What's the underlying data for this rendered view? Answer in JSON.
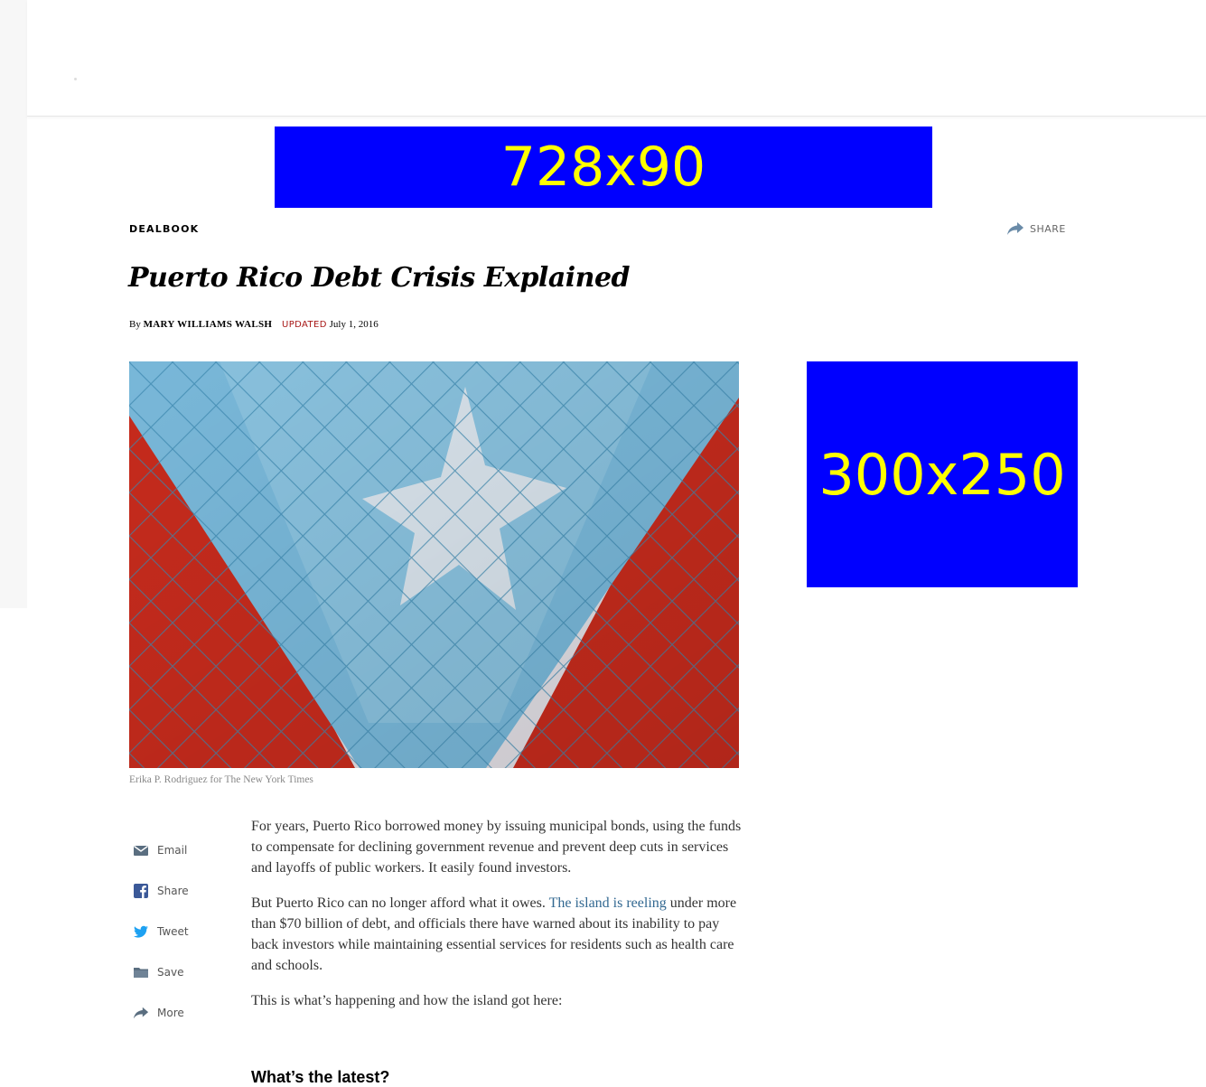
{
  "ads": {
    "top": "728x90",
    "side": "300x250"
  },
  "article": {
    "kicker": "DEALBOOK",
    "share_label": "SHARE",
    "headline": "Puerto Rico Debt Crisis Explained",
    "byline_prefix": "By",
    "author": "MARY WILLIAMS WALSH",
    "updated_label": "UPDATED",
    "date": "July 1, 2016",
    "photo_credit": "Erika P. Rodriguez for The New York Times",
    "paragraphs": {
      "p1": "For years, Puerto Rico borrowed money by issuing municipal bonds, using the funds to compensate for declining government revenue and prevent deep cuts in services and layoffs of public workers. It easily found investors.",
      "p2_before": "But Puerto Rico can no longer afford what it owes. ",
      "p2_link": "The island is reeling",
      "p2_after": " under more than $70 billion of debt, and officials there have warned about its inability to pay back investors while maintaining essential services for residents such as health care and schools.",
      "p3": "This is what’s happening and how the island got here:"
    },
    "subhead": "What’s the latest?"
  },
  "tools": {
    "email": "Email",
    "share": "Share",
    "tweet": "Tweet",
    "save": "Save",
    "more": "More"
  },
  "colors": {
    "ad_bg": "#0000ff",
    "ad_text": "#ffff00",
    "updated": "#a81817",
    "link": "#326891"
  }
}
